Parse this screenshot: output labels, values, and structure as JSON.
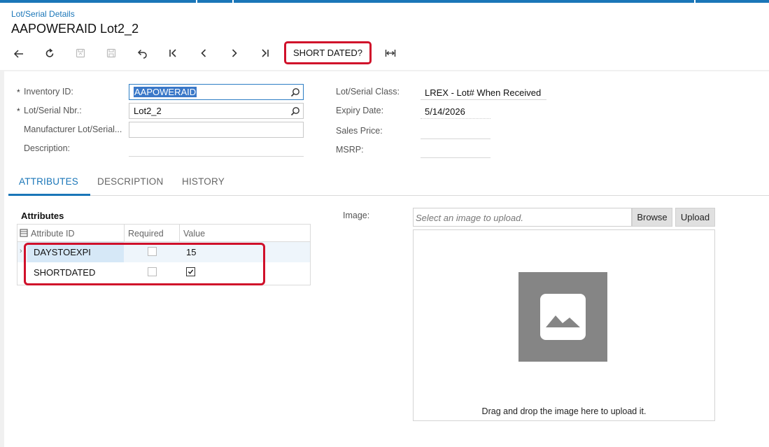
{
  "breadcrumb": "Lot/Serial Details",
  "title": "AAPOWERAID Lot2_2",
  "toolbar": {
    "icons": [
      "back-arrow-icon",
      "refresh-icon",
      "save-close-icon",
      "save-icon",
      "undo-icon",
      "first-record-icon",
      "previous-record-icon",
      "next-record-icon",
      "last-record-icon",
      "fit-width-icon"
    ],
    "short_dated_label": "SHORT DATED?"
  },
  "form": {
    "inventory_id": {
      "label": "Inventory ID:",
      "value": "AAPOWERAID"
    },
    "lot_serial_nbr": {
      "label": "Lot/Serial Nbr.:",
      "value": "Lot2_2"
    },
    "manufacturer_lot": {
      "label": "Manufacturer Lot/Serial...",
      "value": ""
    },
    "description": {
      "label": "Description:",
      "value": ""
    },
    "lot_serial_class": {
      "label": "Lot/Serial Class:",
      "value": "LREX - Lot# When Received"
    },
    "expiry_date": {
      "label": "Expiry Date:",
      "value": "5/14/2026"
    },
    "sales_price": {
      "label": "Sales Price:",
      "value": ""
    },
    "msrp": {
      "label": "MSRP:",
      "value": ""
    },
    "required_marker": "*"
  },
  "tabs": [
    {
      "label": "ATTRIBUTES",
      "active": true
    },
    {
      "label": "DESCRIPTION",
      "active": false
    },
    {
      "label": "HISTORY",
      "active": false
    }
  ],
  "attributes": {
    "section_title": "Attributes",
    "columns": [
      "Attribute ID",
      "Required",
      "Value"
    ],
    "rows": [
      {
        "attribute_id": "DAYSTOEXPI",
        "required": false,
        "value": "15"
      },
      {
        "attribute_id": "SHORTDATED",
        "required": false,
        "value_checked": true
      }
    ]
  },
  "image": {
    "label": "Image:",
    "placeholder": "Select an image to upload.",
    "browse_label": "Browse",
    "upload_label": "Upload",
    "drop_text": "Drag and drop the image here to upload it."
  },
  "colors": {
    "accent": "#1a76b8",
    "highlight": "#d0102a"
  }
}
